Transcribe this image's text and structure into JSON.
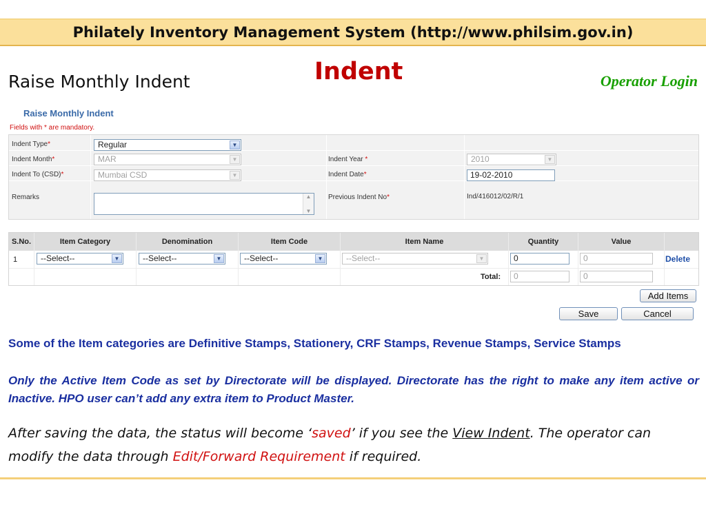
{
  "slide": {
    "banner": "Philately Inventory Management System (http://www.philsim.gov.in)",
    "title": "Indent",
    "subtitle": "Raise Monthly Indent",
    "login_label": "Operator Login"
  },
  "form": {
    "caption": "Raise Monthly Indent",
    "mandatory_note": "Fields with * are mandatory.",
    "indent_type": {
      "label": "Indent Type",
      "value": "Regular"
    },
    "indent_month": {
      "label": "Indent Month",
      "value": "MAR"
    },
    "indent_to": {
      "label": "Indent To (CSD)",
      "value": "Mumbai CSD"
    },
    "remarks": {
      "label": "Remarks",
      "value": ""
    },
    "indent_year": {
      "label": "Indent Year",
      "value": "2010"
    },
    "indent_date": {
      "label": "Indent Date",
      "value": "19-02-2010"
    },
    "previous_indent": {
      "label": "Previous Indent No",
      "value": "Ind/416012/02/R/1"
    }
  },
  "grid": {
    "headers": [
      "S.No.",
      "Item Category",
      "Denomination",
      "Item Code",
      "Item Name",
      "Quantity",
      "Value"
    ],
    "row": {
      "sno": "1",
      "category": "--Select--",
      "denomination": "--Select--",
      "item_code": "--Select--",
      "item_name": "--Select--",
      "quantity": "0",
      "value": "0",
      "delete_label": "Delete"
    },
    "total_label": "Total:",
    "total_quantity": "0",
    "total_value": "0"
  },
  "buttons": {
    "add_items": "Add Items",
    "save": "Save",
    "cancel": "Cancel"
  },
  "info": {
    "categories": "Some of the Item categories are Definitive Stamps, Stationery, CRF Stamps, Revenue Stamps, Service Stamps",
    "active_note": "Only the Active Item Code as set by Directorate will be displayed. Directorate has the right to make any item active or Inactive. HPO user can’t add any extra item to Product Master."
  },
  "note": {
    "part1": "After saving the data, the status will become ‘",
    "saved": "saved",
    "part2": "’ if you see the ",
    "view_indent": "View Indent",
    "part3": ".  The operator can modify the data through ",
    "edit_forward": "Edit/Forward Requirement",
    "part4": " if required."
  },
  "colors": {
    "banner": "#fbe09b",
    "title": "#c00000",
    "login": "#18a000",
    "info": "#1a2fa0",
    "link_blue": "#1f4fa8"
  }
}
